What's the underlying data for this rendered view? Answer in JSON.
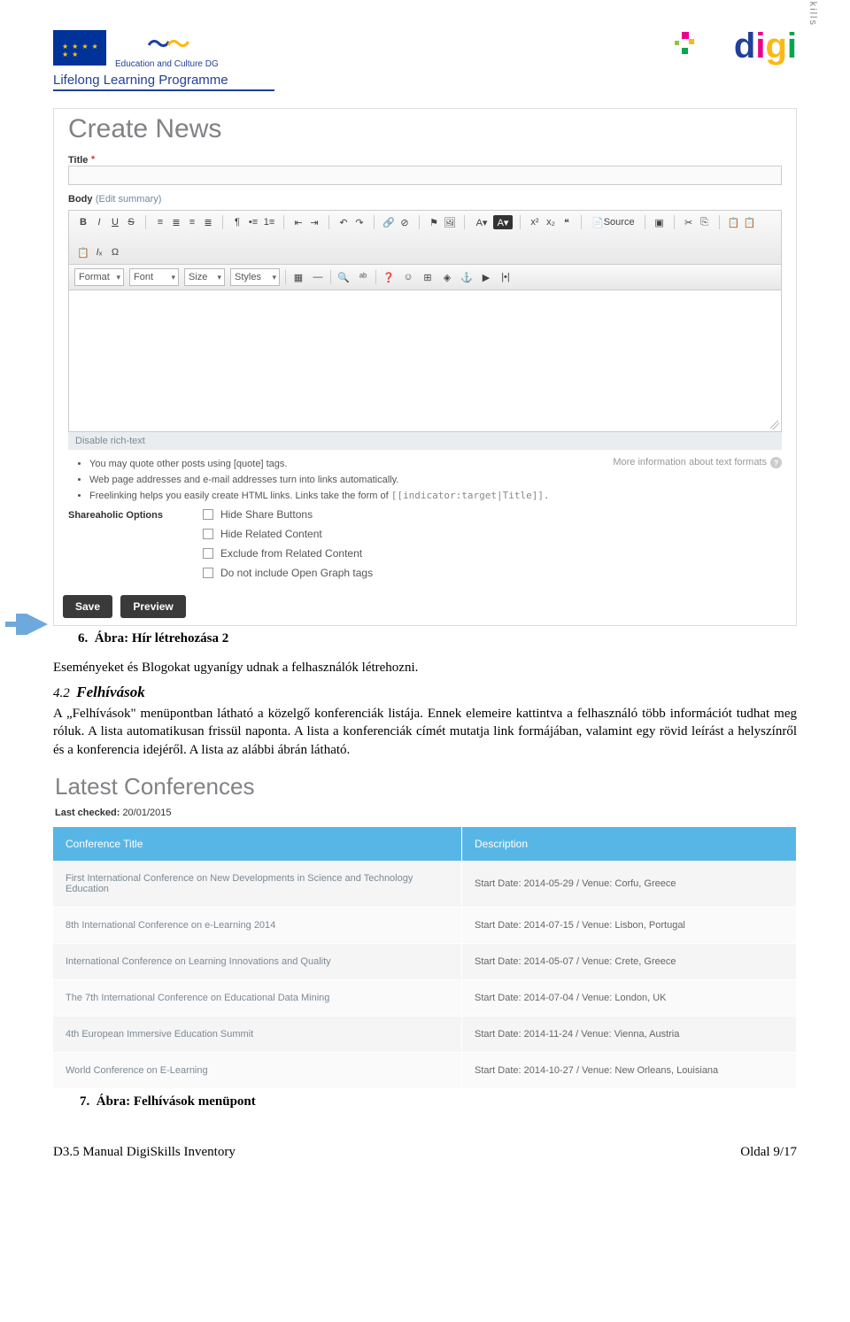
{
  "header": {
    "edc": "Education and Culture DG",
    "llp": "Lifelong Learning Programme",
    "skills": "skills"
  },
  "form": {
    "page_title": "Create News",
    "title_label": "Title",
    "body_label": "Body",
    "edit_summary": "(Edit summary)",
    "toolbar": {
      "format": "Format",
      "font": "Font",
      "size": "Size",
      "styles": "Styles",
      "source": "Source"
    },
    "disable_rt": "Disable rich-text",
    "hints": [
      "You may quote other posts using [quote] tags.",
      "Web page addresses and e-mail addresses turn into links automatically.",
      "Freelinking helps you easily create HTML links. Links take the form of "
    ],
    "hint_code": "[[indicator:target|Title]].",
    "more_info": "More information about text formats",
    "sh_label": "Shareaholic Options",
    "sh_opts": [
      "Hide Share Buttons",
      "Hide Related Content",
      "Exclude from Related Content",
      "Do not include Open Graph tags"
    ],
    "save": "Save",
    "preview": "Preview"
  },
  "text": {
    "caption1_num": "6.",
    "caption1": "Ábra: Hír létrehozása 2",
    "para1": "Eseményeket és Blogokat ugyanígy udnak a felhasználók létrehozni.",
    "sec_num": "4.2",
    "sec_title": "Felhívások",
    "para2": "A „Felhívások\" menüpontban látható a közelgő konferenciák listája. Ennek elemeire kattintva a felhasználó több információt tudhat meg róluk. A lista automatikusan frissül naponta. A lista a konferenciák címét mutatja link formájában, valamint egy rövid leírást a helyszínről és a konferencia idejéről. A lista az alábbi ábrán látható."
  },
  "conf": {
    "title": "Latest Conferences",
    "last_checked_label": "Last checked:",
    "last_checked": "20/01/2015",
    "th_title": "Conference Title",
    "th_desc": "Description",
    "rows": [
      {
        "t": "First International Conference on New Developments in Science and Technology Education",
        "d": "Start Date: 2014-05-29 / Venue: Corfu, Greece"
      },
      {
        "t": "8th International Conference on e-Learning 2014",
        "d": "Start Date: 2014-07-15 / Venue: Lisbon, Portugal"
      },
      {
        "t": "International Conference on Learning Innovations and Quality",
        "d": "Start Date: 2014-05-07 / Venue: Crete, Greece"
      },
      {
        "t": "The 7th International Conference on Educational Data Mining",
        "d": "Start Date: 2014-07-04 / Venue: London, UK"
      },
      {
        "t": "4th European Immersive Education Summit",
        "d": "Start Date: 2014-11-24 / Venue: Vienna, Austria"
      },
      {
        "t": "World Conference on E-Learning",
        "d": "Start Date: 2014-10-27 / Venue: New Orleans, Louisiana"
      }
    ]
  },
  "caption2_num": "7.",
  "caption2": "Ábra: Felhívások menüpont",
  "footer_left": "D3.5 Manual DigiSkills Inventory",
  "footer_right": "Oldal 9/17"
}
